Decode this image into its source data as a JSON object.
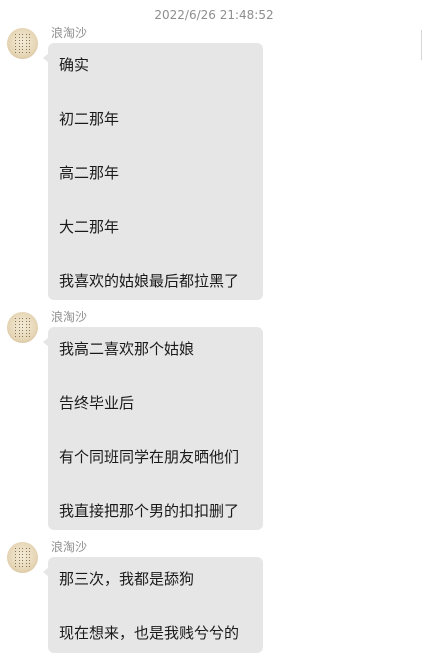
{
  "timestamp": "2022/6/26 21:48:52",
  "messages": [
    {
      "sender": "浪淘沙",
      "lines": [
        "确实",
        "初二那年",
        "高二那年",
        "大二那年",
        "我喜欢的姑娘最后都拉黑了"
      ]
    },
    {
      "sender": "浪淘沙",
      "lines": [
        "我高二喜欢那个姑娘",
        "告终毕业后",
        "有个同班同学在朋友晒他们",
        "我直接把那个男的扣扣删了"
      ]
    },
    {
      "sender": "浪淘沙",
      "lines": [
        "那三次，我都是舔狗",
        "现在想来，也是我贱兮兮的"
      ]
    }
  ]
}
